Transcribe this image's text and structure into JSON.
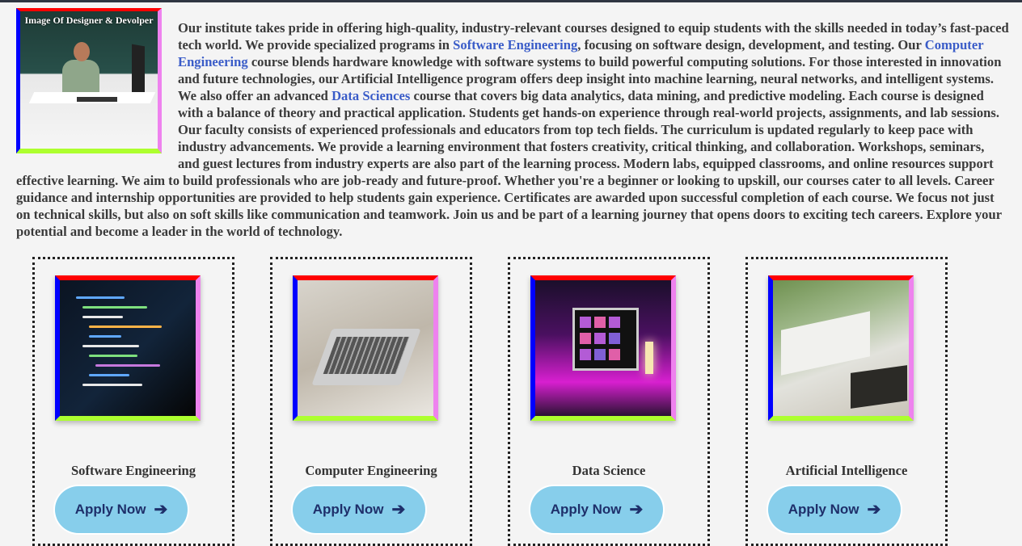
{
  "intro": {
    "image_caption": "Image Of Designer & Devolper",
    "text_1": "Our institute takes pride in offering high-quality, industry-relevant courses designed to equip students with the skills needed in today’s fast-paced tech world. We provide specialized programs in ",
    "link_software": "Software Engineering",
    "text_2": ", focusing on software design, development, and testing. Our ",
    "link_computer": "Computer Engineering",
    "text_3": " course blends hardware knowledge with software systems to build powerful computing solutions. For those interested in innovation and future technologies, our Artificial Intelligence program offers deep insight into machine learning, neural networks, and intelligent systems. We also offer an advanced ",
    "link_data": "Data Sciences",
    "text_4": " course that covers big data analytics, data mining, and predictive modeling. Each course is designed with a balance of theory and practical application. Students get hands-on experience through real-world projects, assignments, and lab sessions. Our faculty consists of experienced professionals and educators from top tech fields. The curriculum is updated regularly to keep pace with industry advancements. We provide a learning environment that fosters creativity, critical thinking, and collaboration. Workshops, seminars, and guest lectures from industry experts are also part of the learning process. Modern labs, equipped classrooms, and online resources support effective learning. We aim to build professionals who are job-ready and future-proof. Whether you're a beginner or looking to upskill, our courses cater to all levels. Career guidance and internship opportunities are provided to help students gain experience. Certificates are awarded upon successful completion of each course. We focus not just on technical skills, but also on soft skills like communication and teamwork. Join us and be part of a learning journey that opens doors to exciting tech careers. Explore your potential and become a leader in the world of technology."
  },
  "cards": [
    {
      "title": "Software Engineering",
      "button": "Apply Now",
      "image": "code-on-screen"
    },
    {
      "title": "Computer Engineering",
      "button": "Apply Now",
      "image": "laptop-typing"
    },
    {
      "title": "Data Science",
      "button": "Apply Now",
      "image": "neon-desk-setup"
    },
    {
      "title": "Artificial Intelligence",
      "button": "Apply Now",
      "image": "books-and-laptop"
    }
  ],
  "colors": {
    "frame_top": "#ff0000",
    "frame_right": "#ee82ee",
    "frame_bottom": "#adff2f",
    "frame_left": "#0000ff",
    "button_bg": "#87ceeb",
    "button_text": "#1e2f6a",
    "link": "#3a5cc8"
  },
  "icons": {
    "apply_arrow": "arrow-right-icon"
  }
}
